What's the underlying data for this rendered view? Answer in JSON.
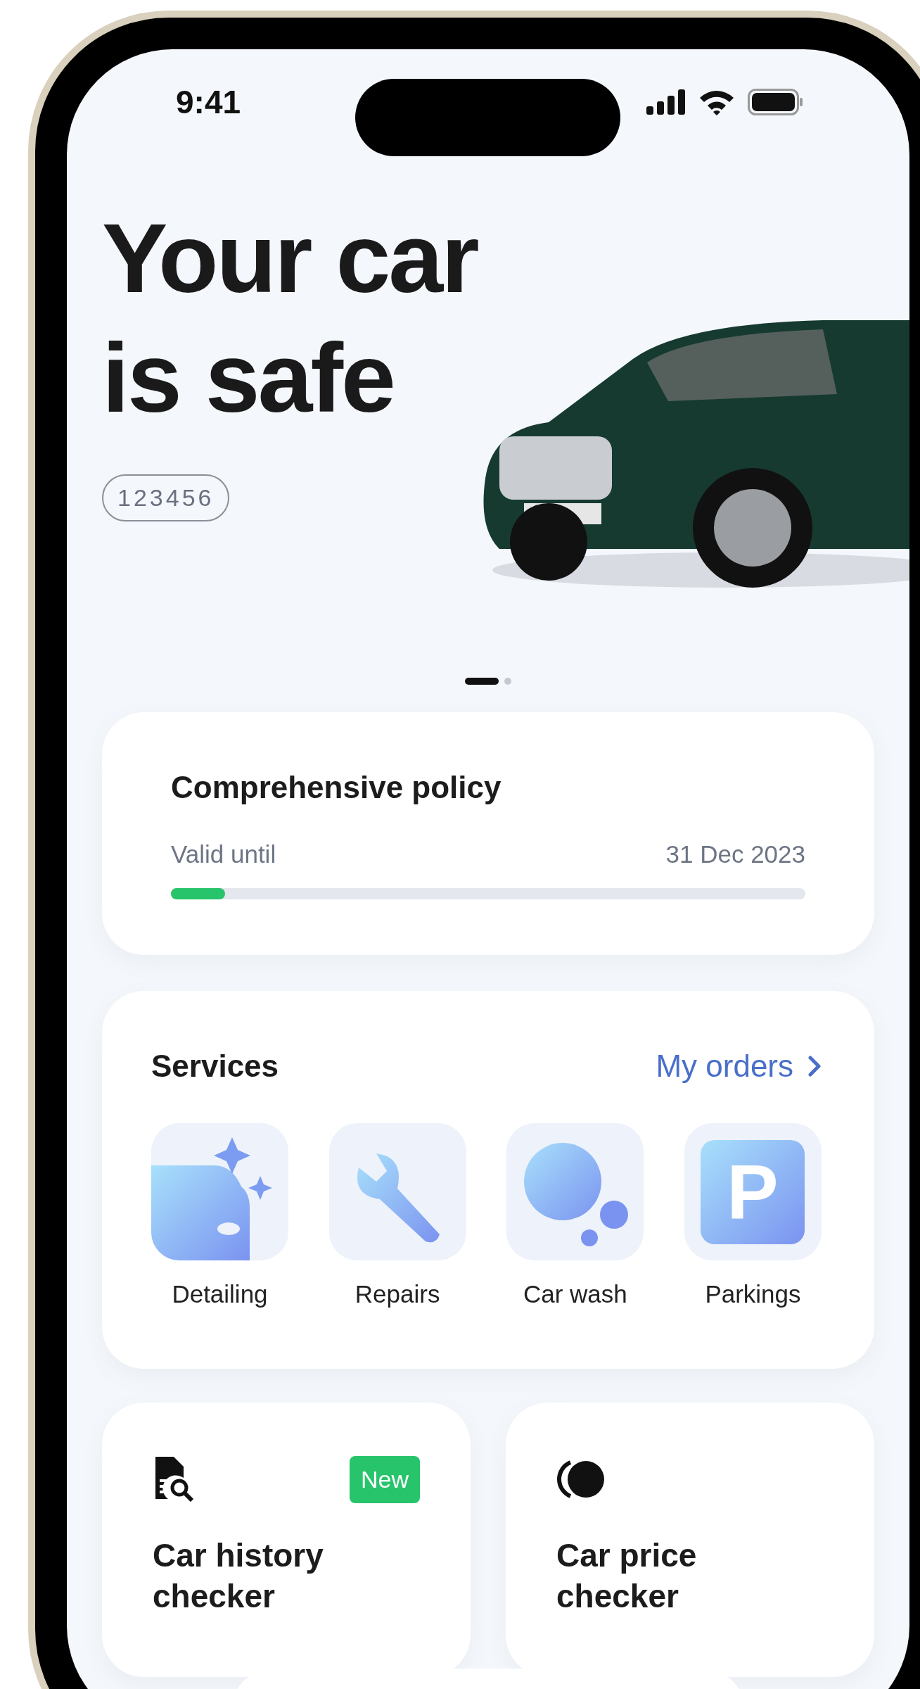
{
  "status_bar": {
    "time": "9:41"
  },
  "hero": {
    "title": "Your car\nis safe",
    "plate": "123456"
  },
  "carousel": [
    {
      "selected": true
    },
    {
      "selected": false
    }
  ],
  "policy": {
    "title": "Comprehensive policy",
    "label": "Valid until",
    "date": "31 Dec 2023",
    "level": 0.085
  },
  "services": {
    "title": "Services",
    "link": "My orders",
    "items": [
      {
        "label": "Detailing",
        "kind": "detailing"
      },
      {
        "label": "Repairs",
        "kind": "repairs"
      },
      {
        "label": "Car wash",
        "kind": "wash"
      },
      {
        "label": "Parkings",
        "kind": "parking",
        "glyph": "P"
      }
    ]
  },
  "tools": [
    {
      "title": "Car history\nchecker",
      "kind": "history",
      "badge": "New"
    },
    {
      "title": "Car price\nchecker",
      "kind": "price"
    }
  ]
}
